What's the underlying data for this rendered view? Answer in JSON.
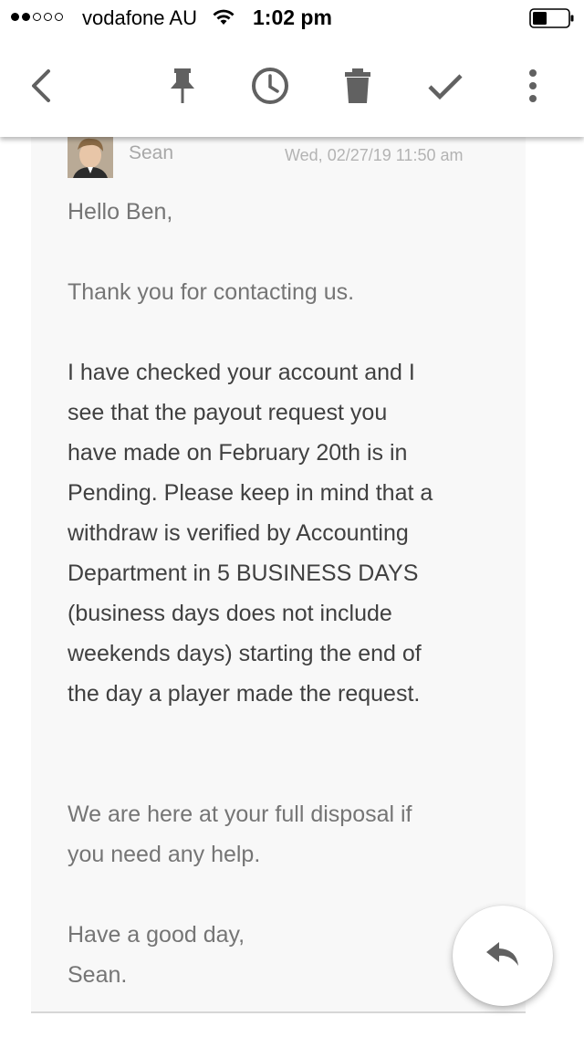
{
  "status_bar": {
    "carrier": "vodafone AU",
    "time": "1:02 pm",
    "signal_bars_filled": 2,
    "signal_bars_total": 5
  },
  "toolbar": {
    "icons": [
      "back-arrow-icon",
      "pin-icon",
      "snooze-clock-icon",
      "trash-icon",
      "checkmark-icon",
      "more-vert-icon"
    ],
    "icon_color": "#616161"
  },
  "message": {
    "sender": "Sean",
    "date": "Wed, 02/27/19 11:50 am",
    "greeting": "Hello Ben,",
    "para1": "Thank you for contacting us.",
    "para2": "I have checked your account and I\nsee that the payout request you\nhave made on February 20th is in\nPending. Please keep in mind that a\nwithdraw is verified by Accounting\nDepartment in 5 BUSINESS DAYS\n(business days does not include\nweekends days) starting the end of\nthe day a player made the request.",
    "para3": "We are here at your full disposal if\nyou need any help.",
    "signoff": "Have a good day,\nSean."
  },
  "fab": {
    "icon": "reply-icon"
  }
}
